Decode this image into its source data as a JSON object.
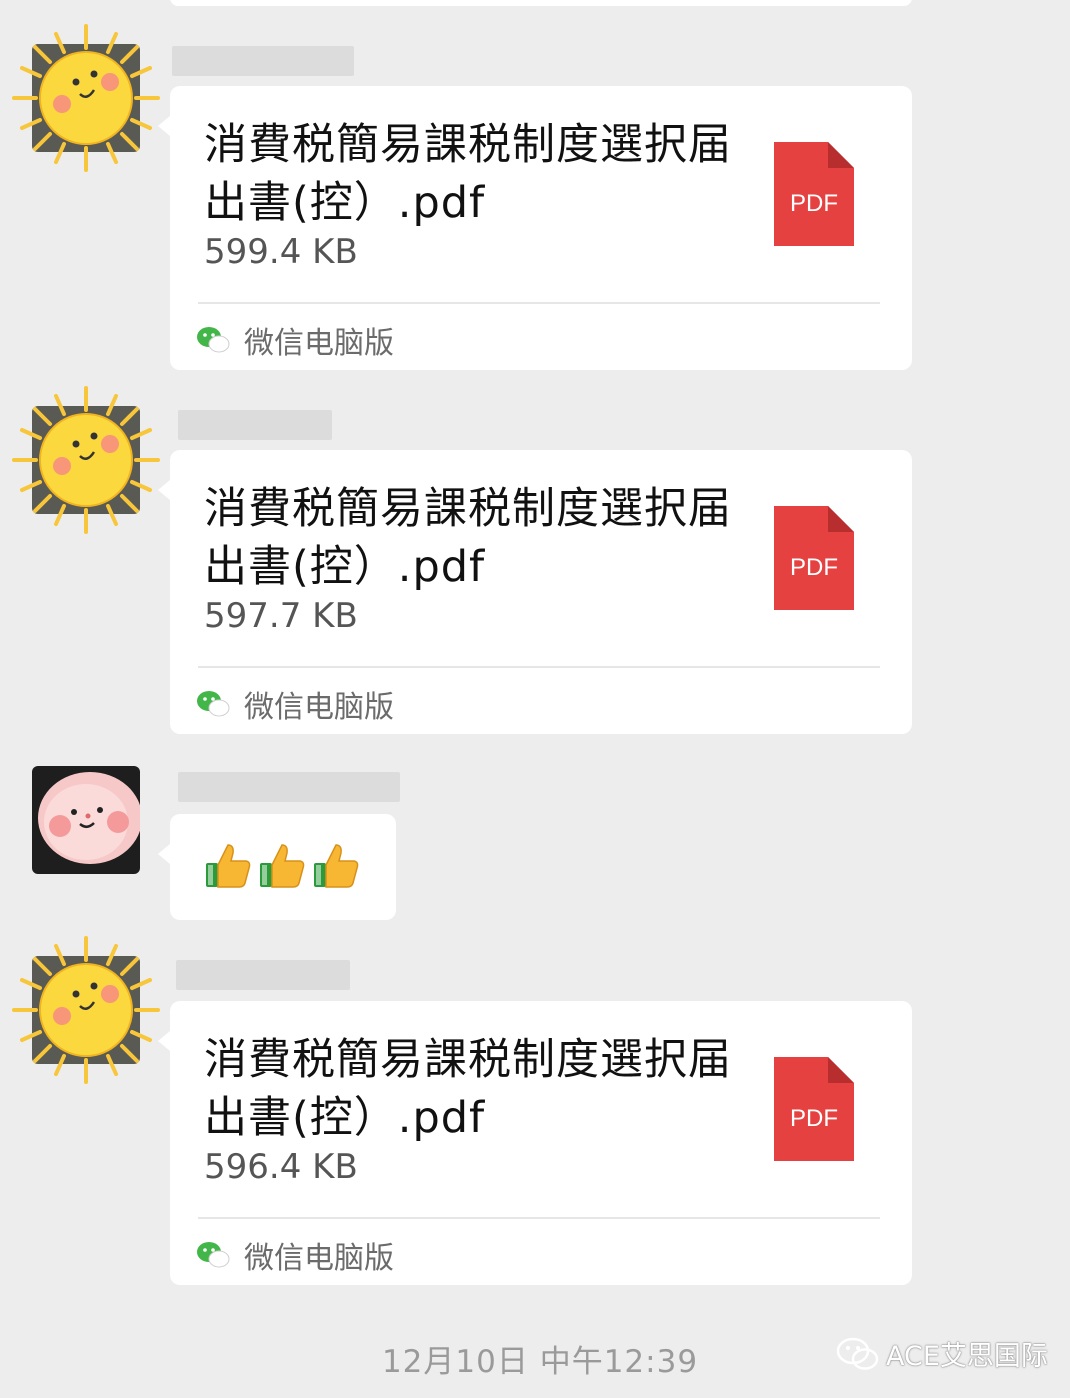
{
  "messages": [
    {
      "file_name": "消費税簡易課税制度選択届出書(控）.pdf",
      "file_size": "599.4 KB",
      "file_type_badge": "PDF",
      "source": "微信电脑版"
    },
    {
      "file_name": "消費税簡易課税制度選択届出書(控）.pdf",
      "file_size": "597.7 KB",
      "file_type_badge": "PDF",
      "source": "微信电脑版"
    },
    {
      "emoji_text": "👍👍👍"
    },
    {
      "file_name": "消費税簡易課税制度選択届出書(控）.pdf",
      "file_size": "596.4 KB",
      "file_type_badge": "PDF",
      "source": "微信电脑版"
    }
  ],
  "timestamp": "12月10日 中午12:39",
  "watermark": "ACE艾思国际",
  "colors": {
    "background": "#ededed",
    "bubble": "#ffffff",
    "pdf_red": "#e54141",
    "wechat_green": "#43b649"
  }
}
